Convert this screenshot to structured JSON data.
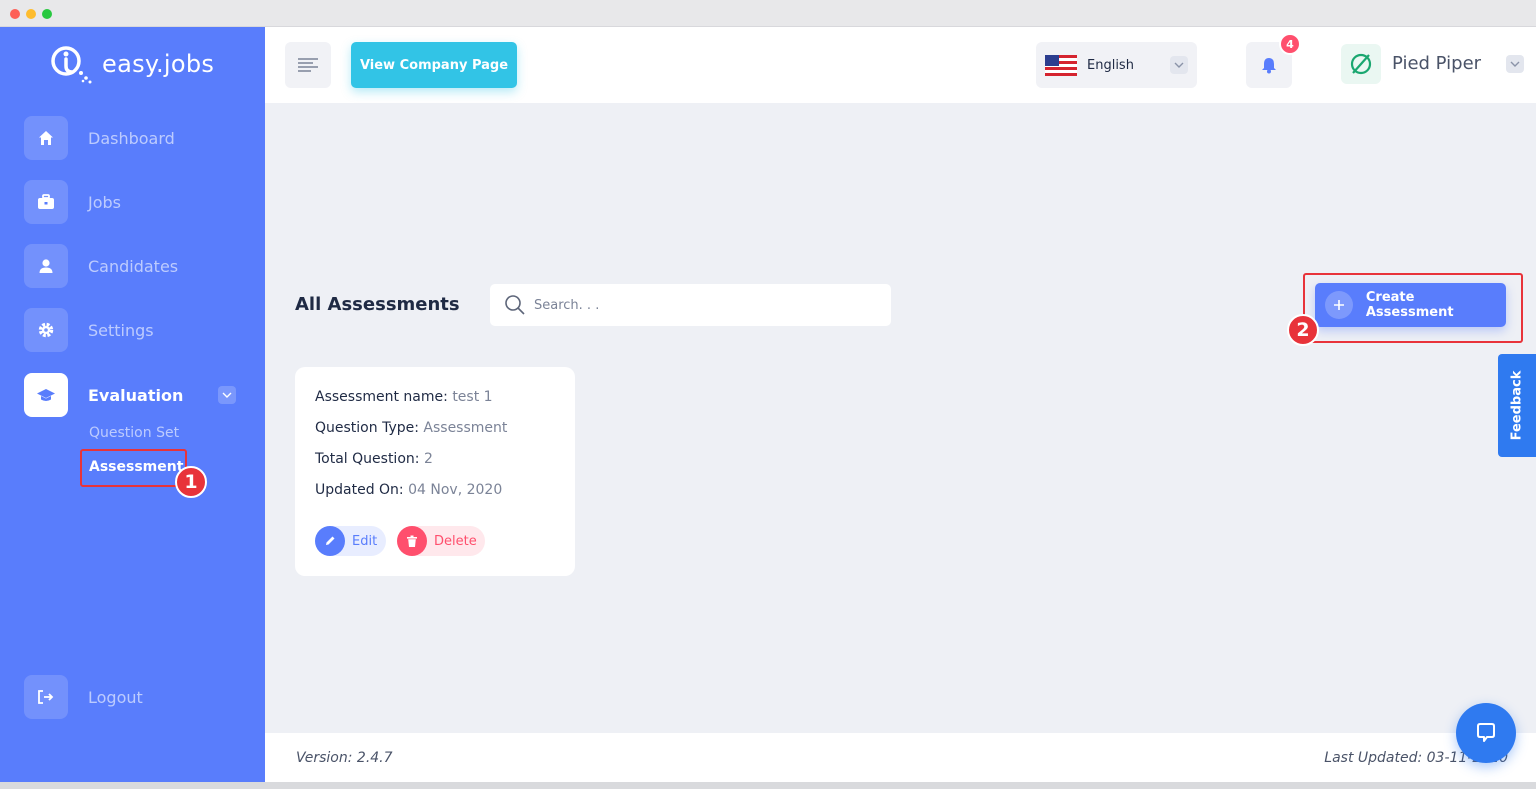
{
  "window": {
    "dot_colors": [
      "#fd5f57",
      "#febc2e",
      "#28c840"
    ]
  },
  "brand": {
    "name": "easy.jobs"
  },
  "sidebar": {
    "items": [
      {
        "label": "Dashboard",
        "icon": "home-icon"
      },
      {
        "label": "Jobs",
        "icon": "briefcase-icon"
      },
      {
        "label": "Candidates",
        "icon": "user-icon"
      },
      {
        "label": "Settings",
        "icon": "gear-icon"
      },
      {
        "label": "Evaluation",
        "icon": "graduation-cap-icon",
        "active": true
      }
    ],
    "sub_items": [
      {
        "label": "Question Set"
      },
      {
        "label": "Assessment",
        "active": true
      }
    ],
    "logout": "Logout"
  },
  "header": {
    "view_company_label": "View Company Page",
    "language": "English",
    "notification_count": "4",
    "company_name": "Pied Piper"
  },
  "main": {
    "title": "All Assessments",
    "search_placeholder": "Search. . .",
    "create_label": "Create Assessment",
    "card": {
      "name_label": "Assessment name:",
      "name_value": "test 1",
      "type_label": "Question Type:",
      "type_value": "Assessment",
      "total_label": "Total Question:",
      "total_value": "2",
      "updated_label": "Updated On:",
      "updated_value": "04 Nov, 2020",
      "edit_label": "Edit",
      "delete_label": "Delete"
    }
  },
  "annotations": {
    "step1": "1",
    "step2": "2"
  },
  "feedback_label": "Feedback",
  "footer": {
    "version": "Version: 2.4.7",
    "last_updated": "Last Updated: 03-11-2020"
  },
  "colors": {
    "sidebar": "#597dfc",
    "primary": "#597dfc",
    "accent": "#32c4e6",
    "danger": "#ff4f6d",
    "highlight": "#e8333a"
  }
}
